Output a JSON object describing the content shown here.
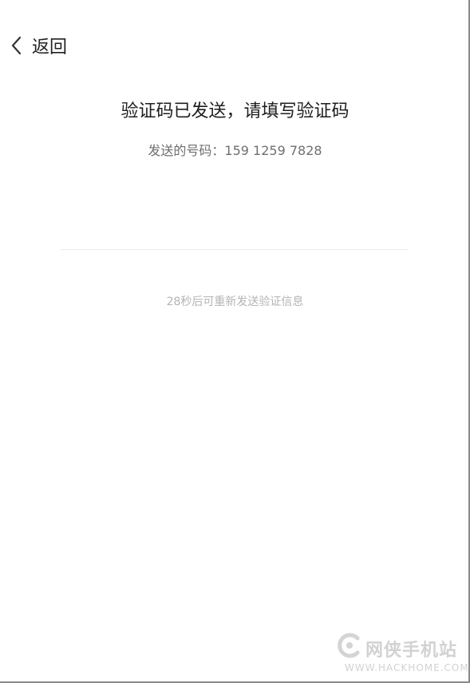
{
  "header": {
    "back_label": "返回",
    "back_icon": "chevron-left-icon"
  },
  "main": {
    "title": "验证码已发送，请填写验证码",
    "phone_text": "发送的号码：159 1259 7828",
    "code_input": {
      "value": "",
      "placeholder": ""
    },
    "resend_text": "28秒后可重新发送验证信息"
  },
  "watermark": {
    "name": "网侠手机站",
    "url": "WWW.HACKHOME.COM",
    "logo_icon": "watermark-logo-icon"
  },
  "colors": {
    "background": "#ffffff",
    "title": "#1e1e1e",
    "secondary_text": "#6f6f6f",
    "hint_text": "#b4b4b4",
    "divider": "#ececec"
  }
}
